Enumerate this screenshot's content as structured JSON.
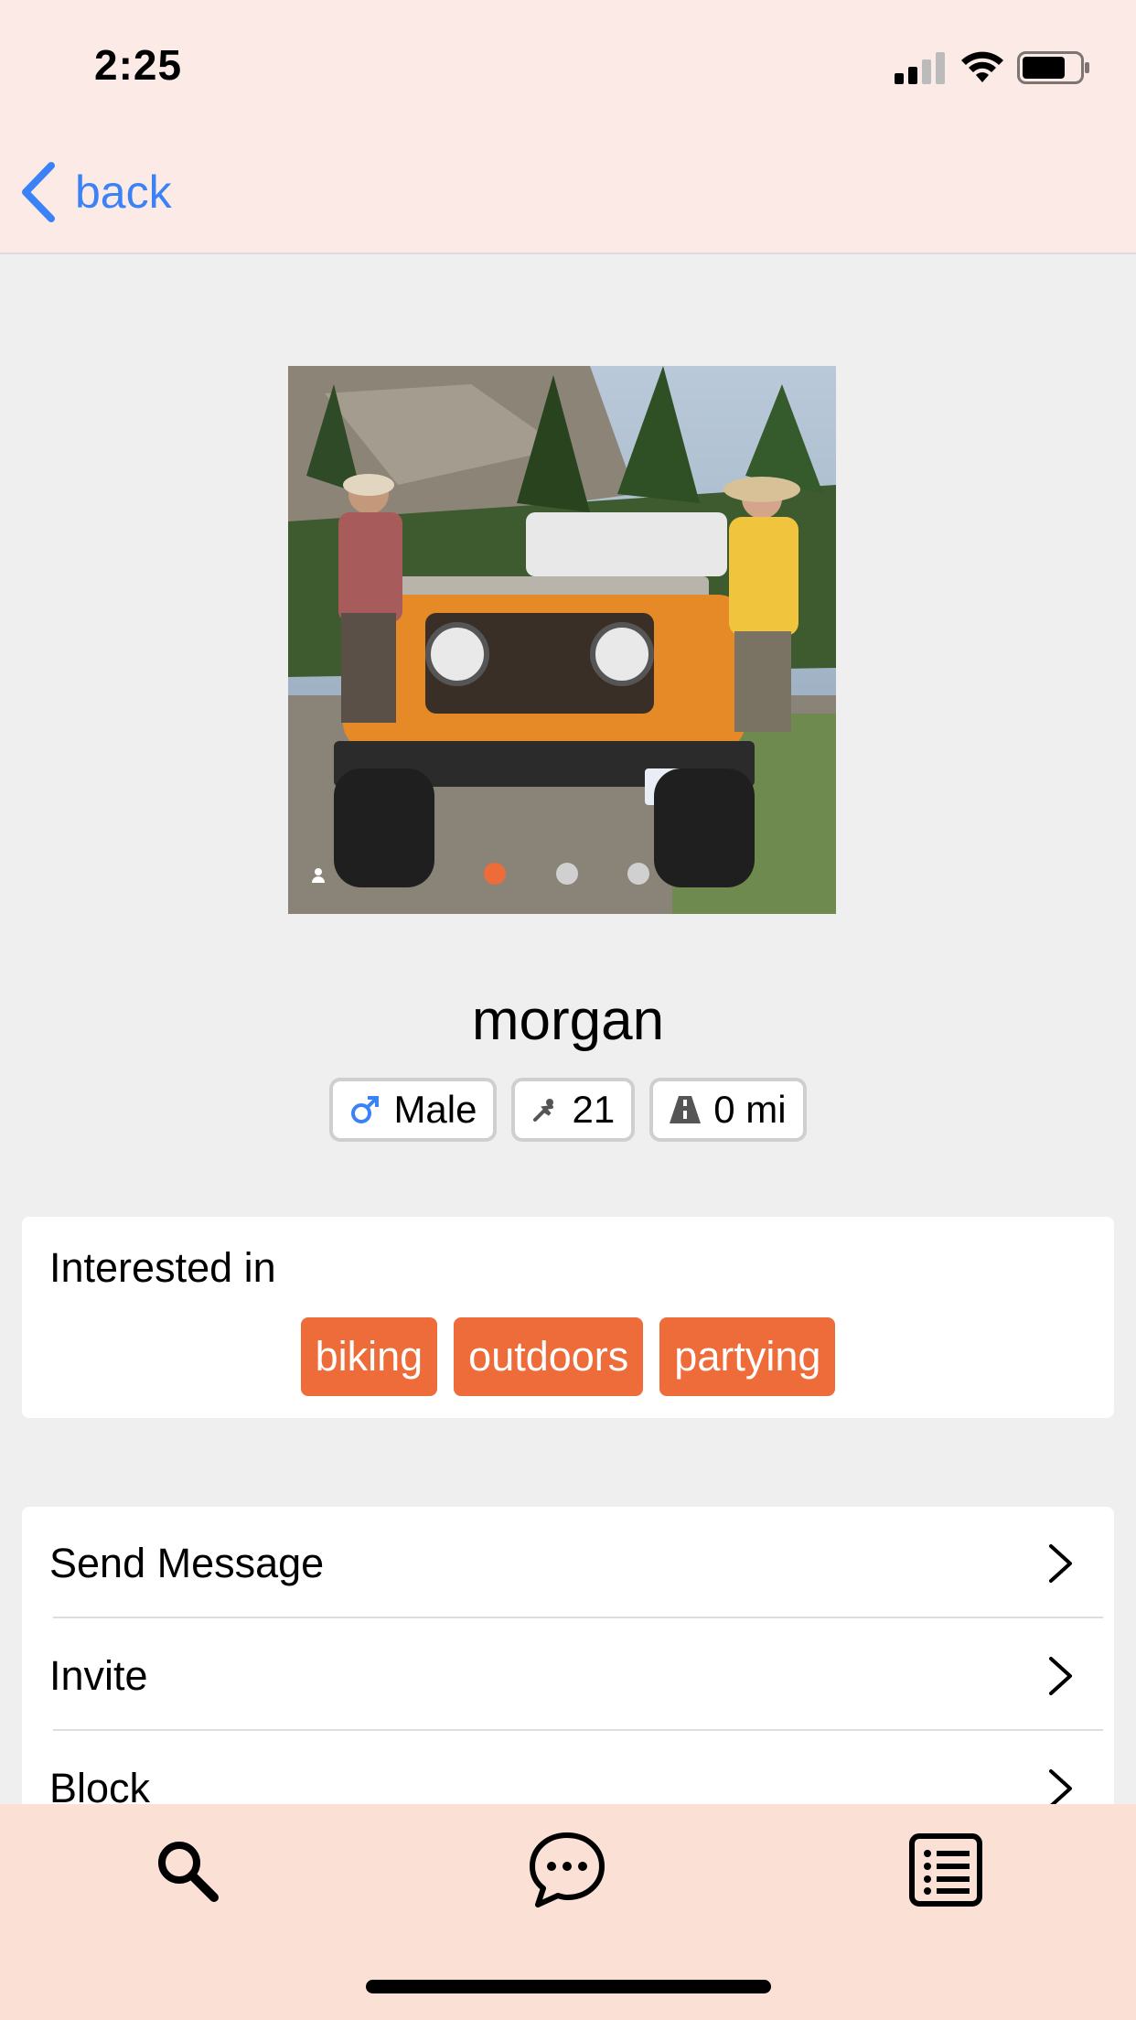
{
  "status_bar": {
    "time": "2:25"
  },
  "nav": {
    "back_label": "back"
  },
  "profile": {
    "name": "morgan",
    "gender": "Male",
    "age": "21",
    "distance": "0 mi",
    "photo_pages": {
      "total": 3,
      "active": 1
    }
  },
  "interests": {
    "title": "Interested in",
    "tags": [
      "biking",
      "outdoors",
      "partying"
    ]
  },
  "actions": [
    "Send Message",
    "Invite",
    "Block"
  ],
  "tabs": [
    "search-icon",
    "chat-bubble-icon",
    "list-icon"
  ],
  "colors": {
    "accent": "#ee6b3a",
    "link": "#3b82f6",
    "header_bg": "#fbeae6",
    "tabbar_bg": "#fbe0d6",
    "page_bg": "#efefef"
  }
}
